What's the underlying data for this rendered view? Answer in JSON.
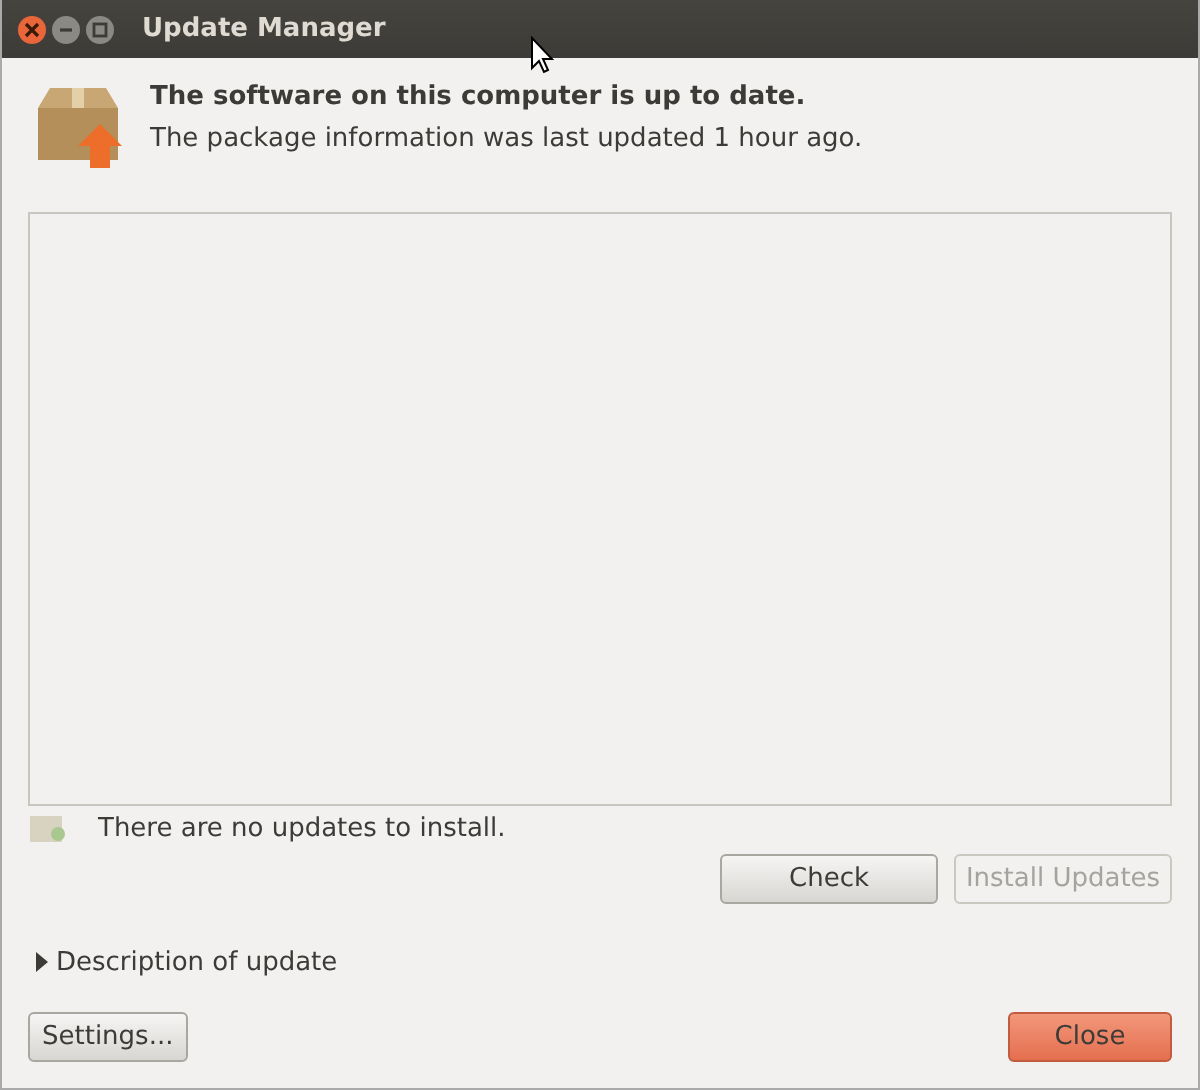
{
  "window": {
    "title": "Update Manager"
  },
  "header": {
    "title": "The software on this computer is up to date.",
    "subtitle": "The package information was last updated 1 hour ago."
  },
  "status": "There are no updates to install.",
  "action_buttons": [
    {
      "label": "Check",
      "disabled": false
    },
    {
      "label": "Install Updates",
      "disabled": true
    }
  ],
  "expander": {
    "label": "Description of update",
    "expanded": false
  },
  "footer_buttons": [
    {
      "label": "Settings...",
      "kind": "normal"
    },
    {
      "label": "Close",
      "kind": "default"
    }
  ]
}
